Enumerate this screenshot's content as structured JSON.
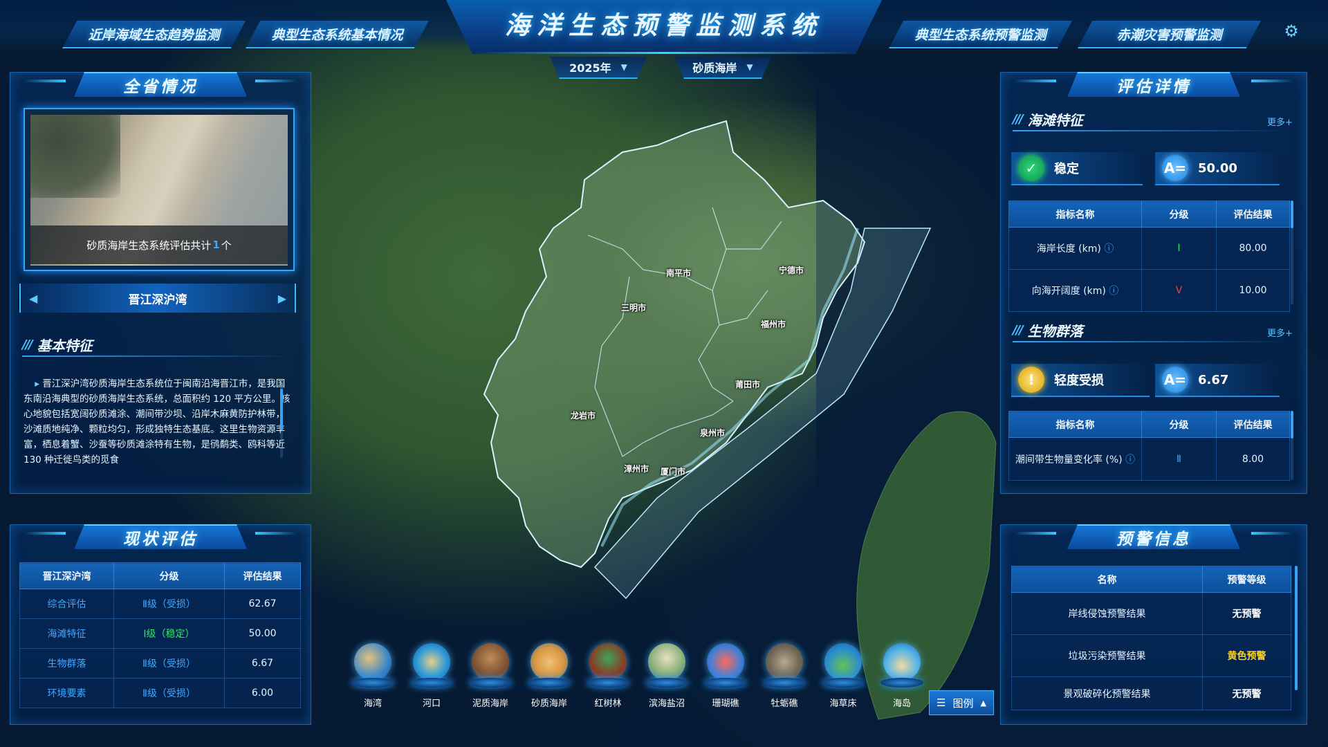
{
  "header": {
    "title": "海洋生态预警监测系统",
    "nav_left": [
      "近岸海域生态趋势监测",
      "典型生态系统基本情况"
    ],
    "nav_right": [
      "典型生态系统预警监测",
      "赤潮灾害预警监测"
    ],
    "year_select": "2025年",
    "type_select": "砂质海岸",
    "settings_icon": "gear-icon"
  },
  "province_panel": {
    "title": "全省情况",
    "photo_caption_prefix": "砂质海岸生态系统评估共计",
    "photo_caption_count": "1",
    "photo_caption_suffix": "个",
    "current_site": "晋江深沪湾",
    "basic_title": "基本特征",
    "basic_text": "晋江深沪湾砂质海岸生态系统位于闽南沿海晋江市，是我国东南沿海典型的砂质海岸生态系统，总面积约 120 平方公里。核心地貌包括宽阔砂质滩涂、潮间带沙坝、沿岸木麻黄防护林带，沙滩质地纯净、颗粒均匀，形成独特生态基底。这里生物资源丰富，栖息着蟹、沙蚕等砂质滩涂特有生物，是鸻鹬类、鸥科等近 130 种迁徙鸟类的觅食"
  },
  "status_panel": {
    "title": "现状评估",
    "columns": [
      "晋江深沪湾",
      "分级",
      "评估结果"
    ],
    "rows": [
      {
        "name": "综合评估",
        "level": "Ⅱ级（受损）",
        "result": "62.67"
      },
      {
        "name": "海滩特征",
        "level": "Ⅰ级（稳定）",
        "result": "50.00"
      },
      {
        "name": "生物群落",
        "level": "Ⅱ级（受损）",
        "result": "6.67"
      },
      {
        "name": "环境要素",
        "level": "Ⅱ级（受损）",
        "result": "6.00"
      }
    ]
  },
  "assessment_panel": {
    "title": "评估详情",
    "beach": {
      "title": "海滩特征",
      "more": "更多+",
      "status": "稳定",
      "score_icon": "A=",
      "score": "50.00",
      "columns": [
        "指标名称",
        "分级",
        "评估结果"
      ],
      "rows": [
        {
          "name": "海岸长度 (km)",
          "level": "Ⅰ",
          "result": "80.00"
        },
        {
          "name": "向海开阔度 (km)",
          "level": "Ⅴ",
          "result": "10.00"
        }
      ]
    },
    "community": {
      "title": "生物群落",
      "more": "更多+",
      "status": "轻度受损",
      "score_icon": "A=",
      "score": "6.67",
      "columns": [
        "指标名称",
        "分级",
        "评估结果"
      ],
      "rows": [
        {
          "name": "潮间带生物量变化率 (%)",
          "level": "Ⅱ",
          "result": "8.00"
        }
      ]
    }
  },
  "warning_panel": {
    "title": "预警信息",
    "columns": [
      "名称",
      "预警等级"
    ],
    "rows": [
      {
        "name": "岸线侵蚀预警结果",
        "level": "无预警"
      },
      {
        "name": "垃圾污染预警结果",
        "level": "黄色预警"
      },
      {
        "name": "景观破碎化预警结果",
        "level": "无预警"
      }
    ]
  },
  "map": {
    "cities": [
      "南平市",
      "宁德市",
      "三明市",
      "福州市",
      "莆田市",
      "龙岩市",
      "泉州市",
      "漳州市",
      "厦门市"
    ]
  },
  "ecosystems": [
    "海湾",
    "河口",
    "泥质海岸",
    "砂质海岸",
    "红树林",
    "滨海盐沼",
    "珊瑚礁",
    "牡蛎礁",
    "海草床",
    "海岛"
  ],
  "legend_label": "图例",
  "colors": {
    "accent": "#2fb6ff",
    "level_1": "#33e36b",
    "level_2": "#3fa7ff",
    "level_5": "#ff3b3b",
    "yellow_warning": "#ffd21f"
  }
}
